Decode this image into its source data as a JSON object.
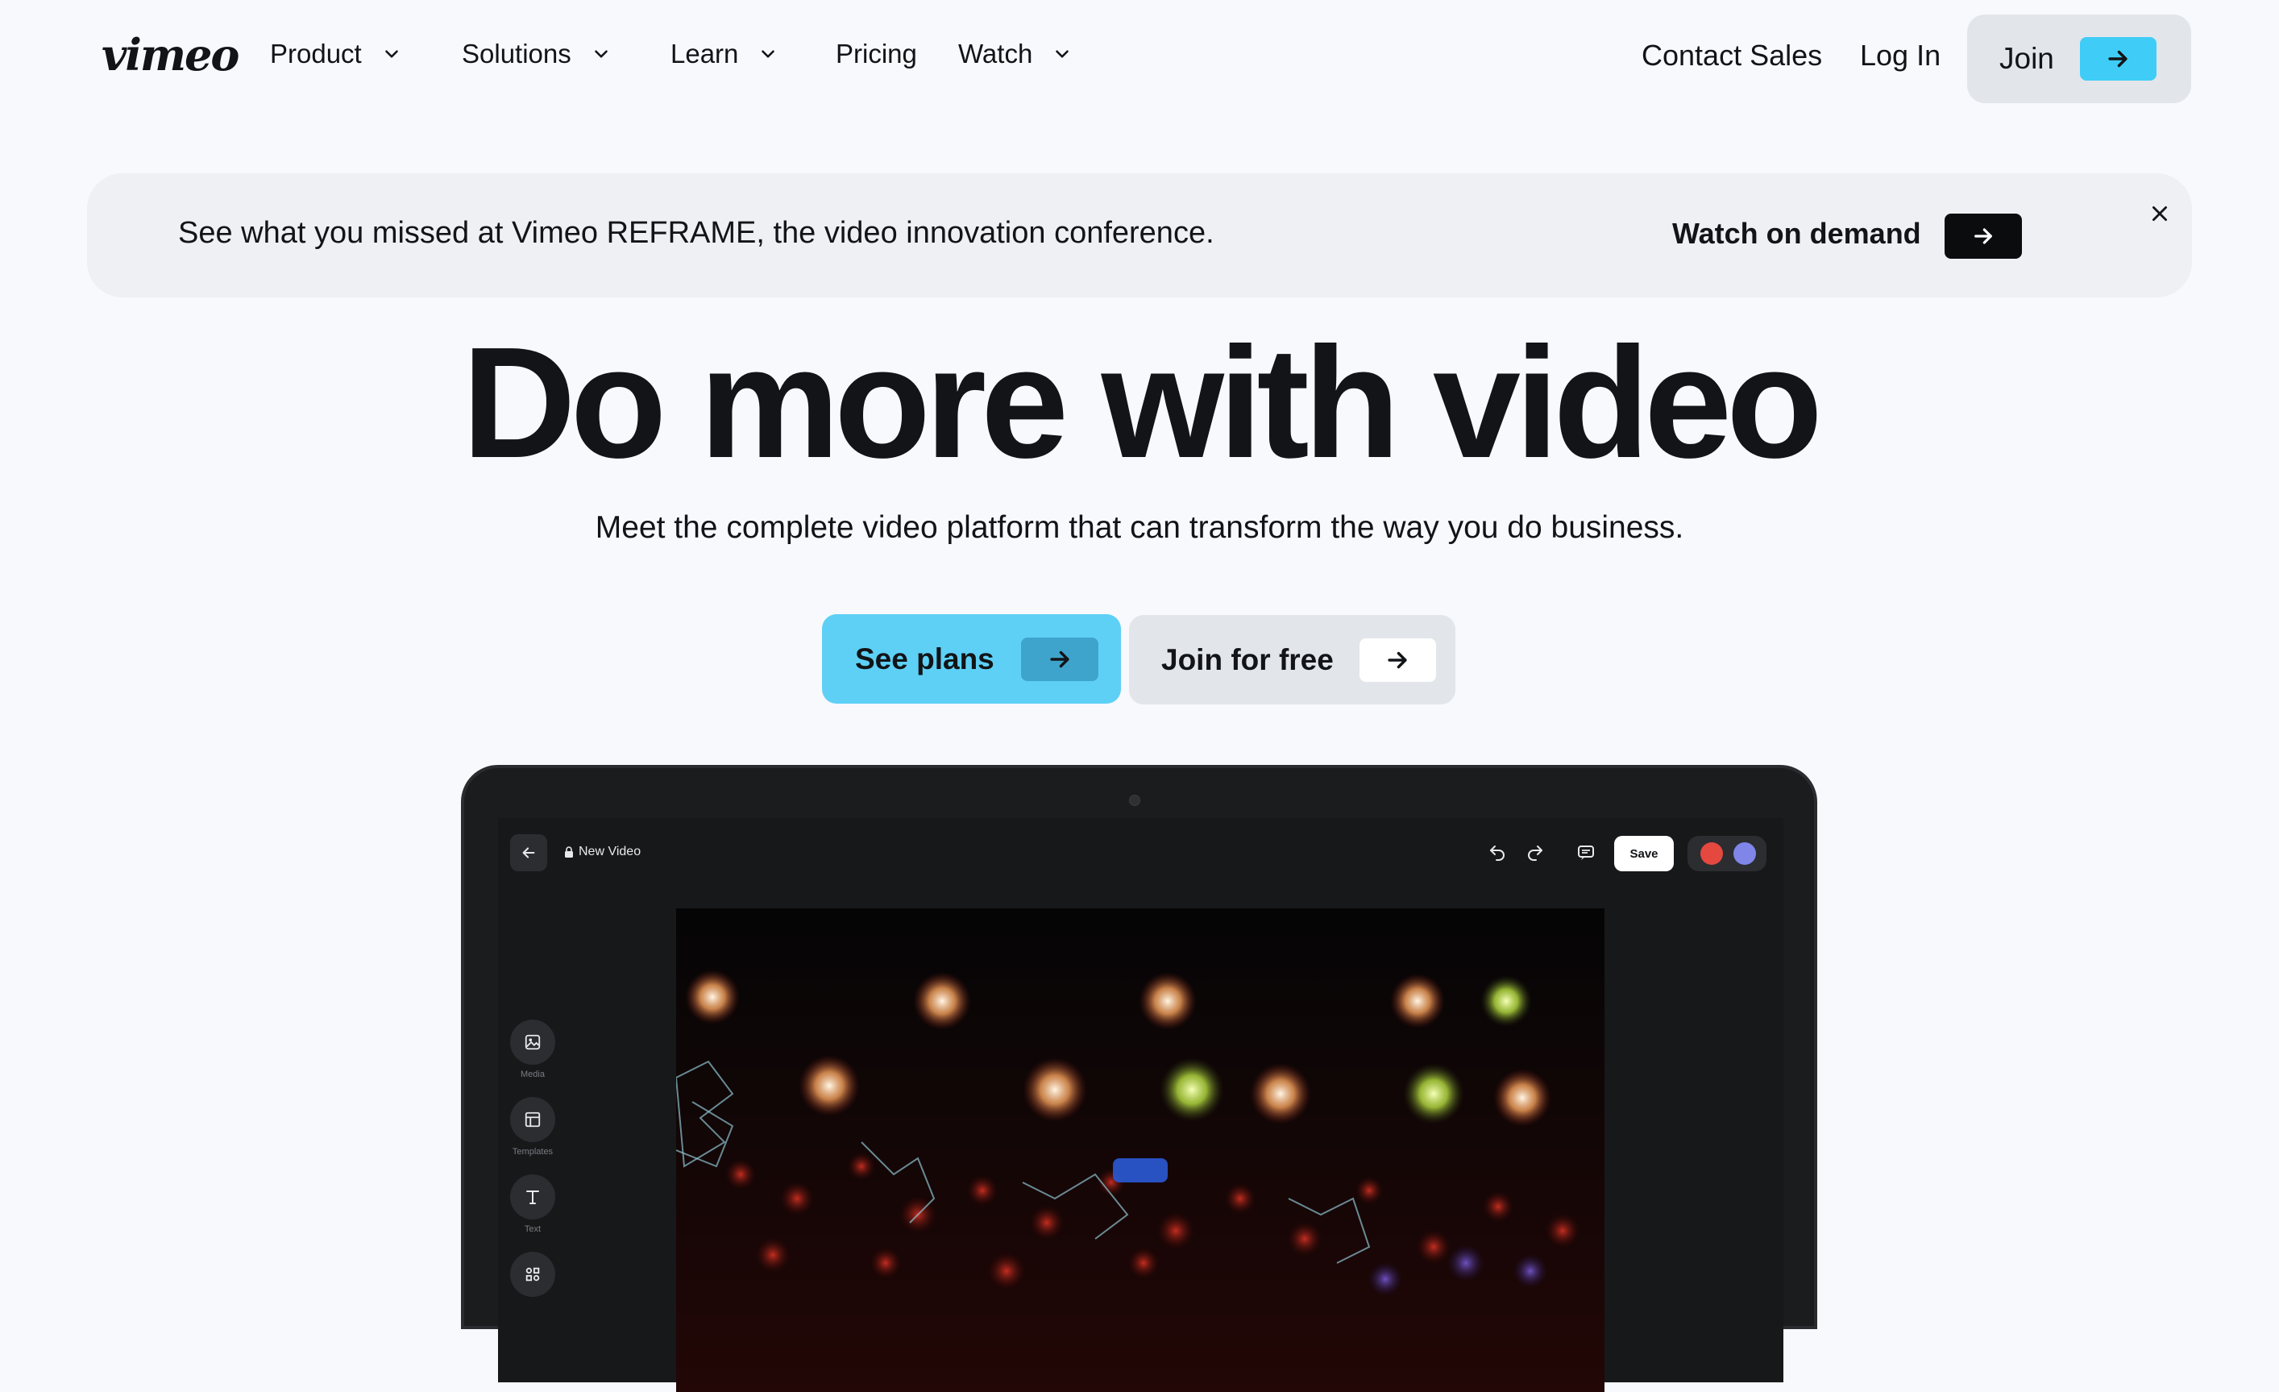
{
  "nav": {
    "logo": "vimeo",
    "items": [
      {
        "label": "Product",
        "has_dropdown": true
      },
      {
        "label": "Solutions",
        "has_dropdown": true
      },
      {
        "label": "Learn",
        "has_dropdown": true
      },
      {
        "label": "Pricing",
        "has_dropdown": false
      },
      {
        "label": "Watch",
        "has_dropdown": true
      }
    ],
    "contact_sales": "Contact Sales",
    "login": "Log In",
    "join": "Join"
  },
  "banner": {
    "text": "See what you missed at Vimeo REFRAME, the video innovation conference.",
    "cta": "Watch on demand"
  },
  "hero": {
    "title": "Do more with video",
    "subtitle": "Meet the complete video platform that can transform the way you do business.",
    "primary_cta": "See plans",
    "secondary_cta": "Join for free"
  },
  "editor": {
    "project_title": "New Video",
    "save_label": "Save",
    "side_tools": [
      {
        "label": "Media",
        "icon": "image-icon"
      },
      {
        "label": "Templates",
        "icon": "layout-icon"
      },
      {
        "label": "Text",
        "icon": "text-icon"
      },
      {
        "label": "",
        "icon": "elements-icon"
      }
    ]
  },
  "colors": {
    "background": "#f8f9fc",
    "accent": "#5ed0f6",
    "text": "#121417",
    "banner_bg": "#eef0f4",
    "button_gray": "#e2e5ea",
    "editor_dark": "#17181a"
  }
}
